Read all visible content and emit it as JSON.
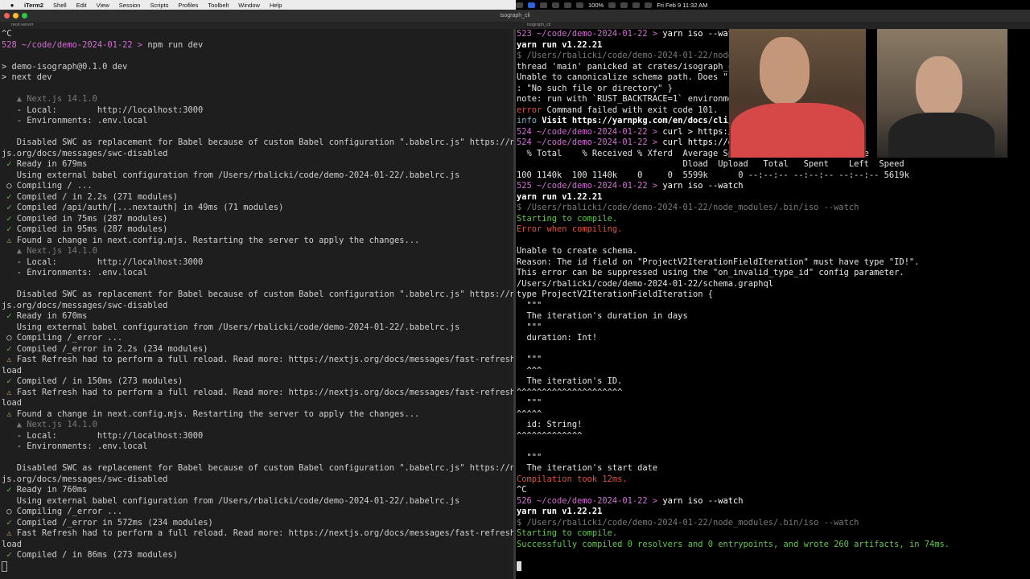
{
  "menubar": {
    "app": "iTerm2",
    "items": [
      "Shell",
      "Edit",
      "View",
      "Session",
      "Scripts",
      "Profiles",
      "Toolbelt",
      "Window",
      "Help"
    ],
    "battery": "100%",
    "clock": "Fri Feb 9  11:32 AM"
  },
  "window": {
    "title": "isograph_cli"
  },
  "tabs": {
    "left": "next-server",
    "right": "isograph_cli"
  },
  "left_pane": {
    "lines": [
      {
        "t": "^C",
        "c": ""
      },
      {
        "t": "528 ~/code/demo-2024-01-22 > npm run dev",
        "c": "prompt"
      },
      {
        "t": "",
        "c": ""
      },
      {
        "t": "> demo-isograph@0.1.0 dev",
        "c": ""
      },
      {
        "t": "> next dev",
        "c": ""
      },
      {
        "t": "",
        "c": ""
      },
      {
        "t": "   ▲ Next.js 14.1.0",
        "c": "dim"
      },
      {
        "t": "   - Local:        http://localhost:3000",
        "c": ""
      },
      {
        "t": "   - Environments: .env.local",
        "c": ""
      },
      {
        "t": "",
        "c": ""
      },
      {
        "t": "   Disabled SWC as replacement for Babel because of custom Babel configuration \".babelrc.js\" https://next",
        "c": ""
      },
      {
        "t": "js.org/docs/messages/swc-disabled",
        "c": ""
      },
      {
        "t": " ✓ Ready in 679ms",
        "c": "ok"
      },
      {
        "t": "   Using external babel configuration from /Users/rbalicki/code/demo-2024-01-22/.babelrc.js",
        "c": ""
      },
      {
        "t": " ○ Compiling / ...",
        "c": ""
      },
      {
        "t": " ✓ Compiled / in 2.2s (271 modules)",
        "c": "ok"
      },
      {
        "t": " ✓ Compiled /api/auth/[...nextauth] in 49ms (71 modules)",
        "c": "ok"
      },
      {
        "t": " ✓ Compiled in 75ms (287 modules)",
        "c": "ok"
      },
      {
        "t": " ✓ Compiled in 95ms (287 modules)",
        "c": "ok"
      },
      {
        "t": " ⚠ Found a change in next.config.mjs. Restarting the server to apply the changes...",
        "c": "warn"
      },
      {
        "t": "   ▲ Next.js 14.1.0",
        "c": "dim"
      },
      {
        "t": "   - Local:        http://localhost:3000",
        "c": ""
      },
      {
        "t": "   - Environments: .env.local",
        "c": ""
      },
      {
        "t": "",
        "c": ""
      },
      {
        "t": "   Disabled SWC as replacement for Babel because of custom Babel configuration \".babelrc.js\" https://next",
        "c": ""
      },
      {
        "t": "js.org/docs/messages/swc-disabled",
        "c": ""
      },
      {
        "t": " ✓ Ready in 670ms",
        "c": "ok"
      },
      {
        "t": "   Using external babel configuration from /Users/rbalicki/code/demo-2024-01-22/.babelrc.js",
        "c": ""
      },
      {
        "t": " ○ Compiling /_error ...",
        "c": ""
      },
      {
        "t": " ✓ Compiled /_error in 2.2s (234 modules)",
        "c": "ok"
      },
      {
        "t": " ⚠ Fast Refresh had to perform a full reload. Read more: https://nextjs.org/docs/messages/fast-refresh-re",
        "c": "warn"
      },
      {
        "t": "load",
        "c": ""
      },
      {
        "t": " ✓ Compiled / in 150ms (273 modules)",
        "c": "ok"
      },
      {
        "t": " ⚠ Fast Refresh had to perform a full reload. Read more: https://nextjs.org/docs/messages/fast-refresh-re",
        "c": "warn"
      },
      {
        "t": "load",
        "c": ""
      },
      {
        "t": " ⚠ Found a change in next.config.mjs. Restarting the server to apply the changes...",
        "c": "warn"
      },
      {
        "t": "   ▲ Next.js 14.1.0",
        "c": "dim"
      },
      {
        "t": "   - Local:        http://localhost:3000",
        "c": ""
      },
      {
        "t": "   - Environments: .env.local",
        "c": ""
      },
      {
        "t": "",
        "c": ""
      },
      {
        "t": "   Disabled SWC as replacement for Babel because of custom Babel configuration \".babelrc.js\" https://next",
        "c": ""
      },
      {
        "t": "js.org/docs/messages/swc-disabled",
        "c": ""
      },
      {
        "t": " ✓ Ready in 760ms",
        "c": "ok"
      },
      {
        "t": "   Using external babel configuration from /Users/rbalicki/code/demo-2024-01-22/.babelrc.js",
        "c": ""
      },
      {
        "t": " ○ Compiling /_error ...",
        "c": ""
      },
      {
        "t": " ✓ Compiled /_error in 572ms (234 modules)",
        "c": "ok"
      },
      {
        "t": " ⚠ Fast Refresh had to perform a full reload. Read more: https://nextjs.org/docs/messages/fast-refresh-re",
        "c": "warn"
      },
      {
        "t": "load",
        "c": ""
      },
      {
        "t": " ✓ Compiled / in 86ms (273 modules)",
        "c": "ok"
      }
    ]
  },
  "right_pane": {
    "lines": [
      {
        "t": "523 ~/code/demo-2024-01-22 > yarn iso --watch",
        "c": "prompt"
      },
      {
        "t": "yarn run v1.22.21",
        "c": "bold"
      },
      {
        "t": "$ /Users/rbalicki/code/demo-2024-01-22/node_",
        "c": "dim"
      },
      {
        "t": "thread 'main' panicked at crates/isograph_cl",
        "c": ""
      },
      {
        "t": "Unable to canonicalize schema path. Does \"./",
        "c": ""
      },
      {
        "t": ": \"No such file or directory\" }",
        "c": ""
      },
      {
        "t": "note: run with `RUST_BACKTRACE=1` environmen",
        "c": ""
      },
      {
        "t": "error Command failed with exit code 101.",
        "c": "errword"
      },
      {
        "t": "info Visit https://yarnpkg.com/en/docs/cli/r",
        "c": "info"
      },
      {
        "t": "524 ~/code/demo-2024-01-22 > curl > https://",
        "c": "prompt"
      },
      {
        "t": "524 ~/code/demo-2024-01-22 > curl https://do",
        "c": "prompt"
      },
      {
        "t": "  % Total    % Received % Xferd  Average Speed   Time    Time     Time  Current",
        "c": ""
      },
      {
        "t": "                                 Dload  Upload   Total   Spent    Left  Speed",
        "c": ""
      },
      {
        "t": "100 1140k  100 1140k    0     0  5599k      0 --:--:-- --:--:-- --:--:-- 5619k",
        "c": ""
      },
      {
        "t": "525 ~/code/demo-2024-01-22 > yarn iso --watch",
        "c": "prompt"
      },
      {
        "t": "yarn run v1.22.21",
        "c": "bold"
      },
      {
        "t": "$ /Users/rbalicki/code/demo-2024-01-22/node_modules/.bin/iso --watch",
        "c": "dim"
      },
      {
        "t": "Starting to compile.",
        "c": "green"
      },
      {
        "t": "Error when compiling.",
        "c": "red"
      },
      {
        "t": "",
        "c": ""
      },
      {
        "t": "Unable to create schema.",
        "c": ""
      },
      {
        "t": "Reason: The id field on \"ProjectV2IterationFieldIteration\" must have type \"ID!\".",
        "c": ""
      },
      {
        "t": "This error can be suppressed using the \"on_invalid_type_id\" config parameter.",
        "c": ""
      },
      {
        "t": "/Users/rbalicki/code/demo-2024-01-22/schema.graphql",
        "c": ""
      },
      {
        "t": "type ProjectV2IterationFieldIteration {",
        "c": ""
      },
      {
        "t": "  \"\"\"",
        "c": ""
      },
      {
        "t": "  The iteration's duration in days",
        "c": ""
      },
      {
        "t": "  \"\"\"",
        "c": ""
      },
      {
        "t": "  duration: Int!",
        "c": ""
      },
      {
        "t": "",
        "c": ""
      },
      {
        "t": "  \"\"\"",
        "c": ""
      },
      {
        "t": "  ^^^",
        "c": ""
      },
      {
        "t": "  The iteration's ID.",
        "c": ""
      },
      {
        "t": "^^^^^^^^^^^^^^^^^^^^^",
        "c": ""
      },
      {
        "t": "  \"\"\"",
        "c": ""
      },
      {
        "t": "^^^^^",
        "c": ""
      },
      {
        "t": "  id: String!",
        "c": ""
      },
      {
        "t": "^^^^^^^^^^^^^",
        "c": ""
      },
      {
        "t": "",
        "c": ""
      },
      {
        "t": "  \"\"\"",
        "c": ""
      },
      {
        "t": "  The iteration's start date",
        "c": ""
      },
      {
        "t": "Compilation took 12ms.",
        "c": "red"
      },
      {
        "t": "^C",
        "c": ""
      },
      {
        "t": "526 ~/code/demo-2024-01-22 > yarn iso --watch",
        "c": "prompt"
      },
      {
        "t": "yarn run v1.22.21",
        "c": "bold"
      },
      {
        "t": "$ /Users/rbalicki/code/demo-2024-01-22/node_modules/.bin/iso --watch",
        "c": "dim"
      },
      {
        "t": "Starting to compile.",
        "c": "green"
      },
      {
        "t": "Successfully compiled 0 resolvers and 0 entrypoints, and wrote 260 artifacts, in 74ms.",
        "c": "green"
      },
      {
        "t": "",
        "c": ""
      }
    ]
  },
  "colors": {
    "prompt_magenta": "#d26ed3",
    "ok_green": "#63c74d",
    "warn_yellow": "#d6b44a",
    "error_red": "#e0533f"
  }
}
